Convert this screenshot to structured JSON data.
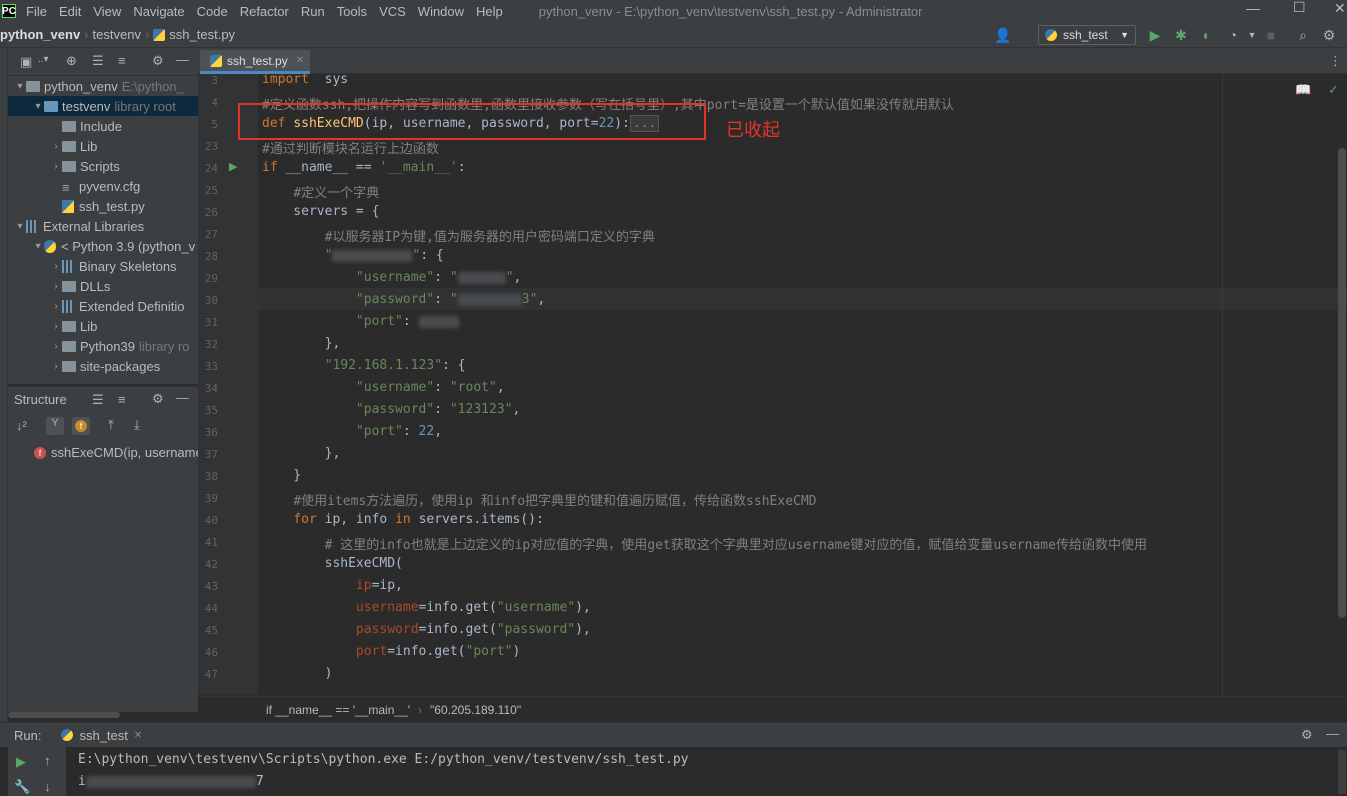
{
  "menu": {
    "logo": "PC",
    "items": [
      "File",
      "Edit",
      "View",
      "Navigate",
      "Code",
      "Refactor",
      "Run",
      "Tools",
      "VCS",
      "Window",
      "Help"
    ],
    "window_title": "python_venv - E:\\python_venv\\testvenv\\ssh_test.py - Administrator"
  },
  "breadcrumb": [
    "python_venv",
    "testvenv",
    "ssh_test.py"
  ],
  "run_config": {
    "label": "ssh_test"
  },
  "project_tree": [
    {
      "label": "python_venv",
      "extra": "E:\\python_",
      "depth": 0,
      "icon": "folder",
      "expanded": true
    },
    {
      "label": "testvenv",
      "extra": "library root",
      "depth": 1,
      "icon": "folder",
      "expanded": true,
      "selected": true
    },
    {
      "label": "Include",
      "extra": "",
      "depth": 2,
      "icon": "folder",
      "expanded": null
    },
    {
      "label": "Lib",
      "extra": "",
      "depth": 2,
      "icon": "folder",
      "expanded": false
    },
    {
      "label": "Scripts",
      "extra": "",
      "depth": 2,
      "icon": "folder",
      "expanded": false
    },
    {
      "label": "pyvenv.cfg",
      "extra": "",
      "depth": 2,
      "icon": "file",
      "expanded": null
    },
    {
      "label": "ssh_test.py",
      "extra": "",
      "depth": 2,
      "icon": "pyfile",
      "expanded": null
    },
    {
      "label": "External Libraries",
      "extra": "",
      "depth": 0,
      "icon": "lib",
      "expanded": true
    },
    {
      "label": "< Python 3.9 (python_v",
      "extra": "",
      "depth": 1,
      "icon": "python",
      "expanded": true
    },
    {
      "label": "Binary Skeletons",
      "extra": "",
      "depth": 2,
      "icon": "lib",
      "expanded": false
    },
    {
      "label": "DLLs",
      "extra": "",
      "depth": 2,
      "icon": "folder",
      "expanded": false
    },
    {
      "label": "Extended Definitio",
      "extra": "",
      "depth": 2,
      "icon": "lib",
      "expanded": false
    },
    {
      "label": "Lib",
      "extra": "",
      "depth": 2,
      "icon": "folder",
      "expanded": false
    },
    {
      "label": "Python39",
      "extra": "library ro",
      "depth": 2,
      "icon": "folder",
      "expanded": false
    },
    {
      "label": "site-packages",
      "extra": "",
      "depth": 2,
      "icon": "folder",
      "expanded": false
    }
  ],
  "structure": {
    "title": "Structure",
    "item": "sshExeCMD(ip, username"
  },
  "editor_tab": "ssh_test.py",
  "annotation": "已收起",
  "status_path": [
    "if __name__ == '__main__'",
    "\"60.205.189.110\""
  ],
  "run": {
    "label": "Run:",
    "tab": "ssh_test",
    "line1": "E:\\python_venv\\testvenv\\Scripts\\python.exe E:/python_venv/testvenv/ssh_test.py",
    "line2_prefix": "i",
    "line2_suffix": "7"
  },
  "code": [
    {
      "n": "3",
      "html": [
        [
          "kw",
          "import"
        ],
        [
          "",
          "  sys"
        ]
      ]
    },
    {
      "n": "4",
      "html": [
        [
          "cmt",
          "#定义函数ssh,把操作内容写到函数里,函数里接收参数（写在括号里）,其中port=是设置一个默认值如果没传就用默认"
        ]
      ]
    },
    {
      "n": "5",
      "html": [
        [
          "kw",
          "def "
        ],
        [
          "fn",
          "sshExeCMD"
        ],
        [
          "",
          "(ip, username, password, port="
        ],
        [
          "num",
          "22"
        ],
        [
          "",
          "):"
        ],
        [
          "fold",
          "..."
        ]
      ]
    },
    {
      "n": "23",
      "html": [
        [
          "cmt",
          "#通过判断模块名运行上边函数"
        ]
      ]
    },
    {
      "n": "24",
      "html": [
        [
          "kw",
          "if "
        ],
        [
          "",
          "__name__ == "
        ],
        [
          "str",
          "'__main__'"
        ],
        [
          "",
          ":"
        ]
      ]
    },
    {
      "n": "25",
      "html": [
        [
          "",
          "    "
        ],
        [
          "cmt",
          "#定义一个字典"
        ]
      ]
    },
    {
      "n": "26",
      "html": [
        [
          "",
          "    servers = {"
        ]
      ]
    },
    {
      "n": "27",
      "html": [
        [
          "",
          "        "
        ],
        [
          "cmt",
          "#以服务器IP为键,值为服务器的用户密码端口定义的字典"
        ]
      ]
    },
    {
      "n": "28",
      "html": [
        [
          "",
          "        "
        ],
        [
          "str",
          "\""
        ],
        [
          "blur",
          "xxxxxxxxxx"
        ],
        [
          "str",
          "\""
        ],
        [
          "",
          ": {"
        ]
      ]
    },
    {
      "n": "29",
      "html": [
        [
          "",
          "            "
        ],
        [
          "str",
          "\"username\""
        ],
        [
          "",
          ": "
        ],
        [
          "str",
          "\""
        ],
        [
          "blur",
          "xxxxxx"
        ],
        [
          "str",
          "\""
        ],
        [
          "",
          ","
        ]
      ]
    },
    {
      "n": "30",
      "html": [
        [
          "",
          "            "
        ],
        [
          "str",
          "\"password\""
        ],
        [
          "",
          ": "
        ],
        [
          "str",
          "\""
        ],
        [
          "blur",
          "xxxxxxxx"
        ],
        [
          "str",
          "3\""
        ],
        [
          "",
          ","
        ]
      ]
    },
    {
      "n": "31",
      "html": [
        [
          "",
          "            "
        ],
        [
          "str",
          "\"port\""
        ],
        [
          "",
          ": "
        ],
        [
          "blur",
          "xxxxx"
        ]
      ]
    },
    {
      "n": "32",
      "html": [
        [
          "",
          "        },"
        ]
      ]
    },
    {
      "n": "33",
      "html": [
        [
          "",
          "        "
        ],
        [
          "str",
          "\"192.168.1.123\""
        ],
        [
          "",
          ": {"
        ]
      ]
    },
    {
      "n": "34",
      "html": [
        [
          "",
          "            "
        ],
        [
          "str",
          "\"username\""
        ],
        [
          "",
          ": "
        ],
        [
          "str",
          "\"root\""
        ],
        [
          "",
          ","
        ]
      ]
    },
    {
      "n": "35",
      "html": [
        [
          "",
          "            "
        ],
        [
          "str",
          "\"password\""
        ],
        [
          "",
          ": "
        ],
        [
          "str",
          "\"123123\""
        ],
        [
          "",
          ","
        ]
      ]
    },
    {
      "n": "36",
      "html": [
        [
          "",
          "            "
        ],
        [
          "str",
          "\"port\""
        ],
        [
          "",
          ": "
        ],
        [
          "num",
          "22"
        ],
        [
          "",
          ","
        ]
      ]
    },
    {
      "n": "37",
      "html": [
        [
          "",
          "        },"
        ]
      ]
    },
    {
      "n": "38",
      "html": [
        [
          "",
          "    }"
        ]
      ]
    },
    {
      "n": "39",
      "html": [
        [
          "",
          "    "
        ],
        [
          "cmt",
          "#使用items方法遍历，使用ip 和info把字典里的键和值遍历赋值，传给函数sshExeCMD"
        ]
      ]
    },
    {
      "n": "40",
      "html": [
        [
          "",
          "    "
        ],
        [
          "kw",
          "for "
        ],
        [
          "",
          "ip, info "
        ],
        [
          "kw",
          "in "
        ],
        [
          "",
          "servers.items():"
        ]
      ]
    },
    {
      "n": "41",
      "html": [
        [
          "",
          "        "
        ],
        [
          "cmt",
          "# 这里的info也就是上边定义的ip对应值的字典，使用get获取这个字典里对应username键对应的值，赋值给变量username传给函数中使用"
        ]
      ]
    },
    {
      "n": "42",
      "html": [
        [
          "",
          "        sshExeCMD("
        ]
      ]
    },
    {
      "n": "43",
      "html": [
        [
          "",
          "            "
        ],
        [
          "param",
          "ip"
        ],
        [
          "",
          "=ip,"
        ]
      ]
    },
    {
      "n": "44",
      "html": [
        [
          "",
          "            "
        ],
        [
          "param",
          "username"
        ],
        [
          "",
          "=info.get("
        ],
        [
          "str",
          "\"username\""
        ],
        [
          "",
          "),"
        ]
      ]
    },
    {
      "n": "45",
      "html": [
        [
          "",
          "            "
        ],
        [
          "param",
          "password"
        ],
        [
          "",
          "=info.get("
        ],
        [
          "str",
          "\"password\""
        ],
        [
          "",
          "),"
        ]
      ]
    },
    {
      "n": "46",
      "html": [
        [
          "",
          "            "
        ],
        [
          "param",
          "port"
        ],
        [
          "",
          "=info.get("
        ],
        [
          "str",
          "\"port\""
        ],
        [
          "",
          ")"
        ]
      ]
    },
    {
      "n": "47",
      "html": [
        [
          "",
          "        )"
        ]
      ]
    }
  ]
}
